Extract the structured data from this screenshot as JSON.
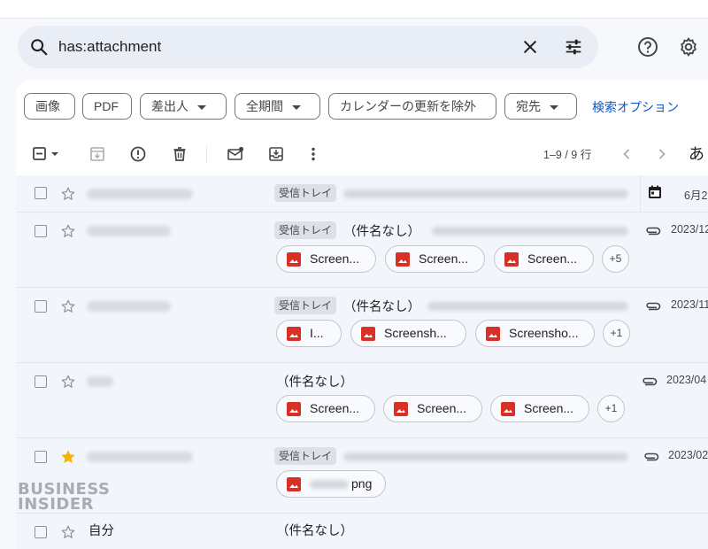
{
  "search": {
    "query": "has:attachment"
  },
  "filters": {
    "chips": [
      {
        "label": "画像",
        "dropdown": false
      },
      {
        "label": "PDF",
        "dropdown": false
      },
      {
        "label": "差出人",
        "dropdown": true
      },
      {
        "label": "全期間",
        "dropdown": true
      },
      {
        "label": "カレンダーの更新を除外",
        "dropdown": false
      },
      {
        "label": "宛先",
        "dropdown": true
      }
    ],
    "advanced_link": "検索オプション"
  },
  "toolbar": {
    "count": "1–9 / 9 行",
    "partial_glyph": "あ"
  },
  "emails": [
    {
      "label": "受信トレイ",
      "subject": "",
      "starred": false,
      "date": "6月2",
      "date_icon": "calendar",
      "attachments": [],
      "more": ""
    },
    {
      "label": "受信トレイ",
      "subject": "（件名なし）",
      "starred": false,
      "date": "2023/12",
      "date_icon": "paperclip",
      "attachments": [
        "Screen...",
        "Screen...",
        "Screen..."
      ],
      "more": "+5"
    },
    {
      "label": "受信トレイ",
      "subject": "（件名なし）",
      "starred": false,
      "date": "2023/11",
      "date_icon": "paperclip",
      "attachments": [
        "I...",
        "Screensh...",
        "Screensho..."
      ],
      "more": "+1"
    },
    {
      "label": "",
      "subject": "（件名なし）",
      "starred": false,
      "date": "2023/04",
      "date_icon": "paperclip",
      "attachments": [
        "Screen...",
        "Screen...",
        "Screen..."
      ],
      "more": "+1"
    },
    {
      "label": "受信トレイ",
      "subject": "",
      "starred": true,
      "date": "2023/02",
      "date_icon": "paperclip",
      "attachments": [
        "png"
      ],
      "more": ""
    },
    {
      "label": "",
      "subject": "（件名なし）",
      "starred": false,
      "date": "",
      "date_icon": "",
      "attachments": [],
      "more": ""
    }
  ],
  "partial_sender_last": "自分",
  "watermark": {
    "line1": "BUSINESS",
    "line2": "INSIDER"
  },
  "colors": {
    "accent": "#0b57d0",
    "star": "#f4b400",
    "image_icon": "#d93025",
    "background": "#f6f8fc"
  }
}
